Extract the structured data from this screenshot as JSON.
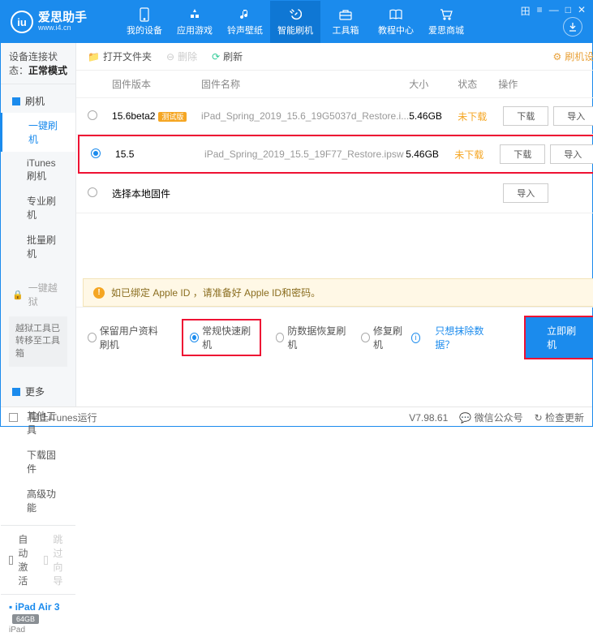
{
  "app": {
    "name": "爱思助手",
    "url": "www.i4.cn"
  },
  "nav": {
    "tabs": [
      "我的设备",
      "应用游戏",
      "铃声壁纸",
      "智能刷机",
      "工具箱",
      "教程中心",
      "爱思商城"
    ],
    "active": 3
  },
  "sidebar": {
    "status_label": "设备连接状态：",
    "status_value": "正常模式",
    "groups": {
      "flash": {
        "title": "刷机",
        "items": [
          "一键刷机",
          "iTunes刷机",
          "专业刷机",
          "批量刷机"
        ],
        "active": 0
      },
      "jailbreak": {
        "title": "一键越狱",
        "note": "越狱工具已转移至工具箱"
      },
      "more": {
        "title": "更多",
        "items": [
          "其他工具",
          "下载固件",
          "高级功能"
        ]
      }
    },
    "auto_activate": "自动激活",
    "skip_guide": "跳过向导",
    "device": {
      "name": "iPad Air 3",
      "storage": "64GB",
      "type": "iPad"
    }
  },
  "toolbar": {
    "open": "打开文件夹",
    "delete": "删除",
    "refresh": "刷新",
    "settings": "刷机设置"
  },
  "grid": {
    "headers": {
      "version": "固件版本",
      "name": "固件名称",
      "size": "大小",
      "status": "状态",
      "ops": "操作"
    },
    "rows": [
      {
        "version": "15.6beta2",
        "badge": "测试版",
        "name": "iPad_Spring_2019_15.6_19G5037d_Restore.i...",
        "size": "5.46GB",
        "status": "未下载",
        "selected": false
      },
      {
        "version": "15.5",
        "badge": "",
        "name": "iPad_Spring_2019_15.5_19F77_Restore.ipsw",
        "size": "5.46GB",
        "status": "未下载",
        "selected": true
      }
    ],
    "local": "选择本地固件",
    "ops": {
      "download": "下载",
      "import": "导入"
    }
  },
  "warn": "如已绑定 Apple ID ，请准备好 Apple ID和密码。",
  "modes": {
    "keep": "保留用户资料刷机",
    "normal": "常规快速刷机",
    "recovery": "防数据恢复刷机",
    "repair": "修复刷机",
    "erase_link": "只想抹除数据？",
    "go": "立即刷机"
  },
  "footer": {
    "block": "阻止iTunes运行",
    "version": "V7.98.61",
    "wechat": "微信公众号",
    "check": "检查更新"
  }
}
